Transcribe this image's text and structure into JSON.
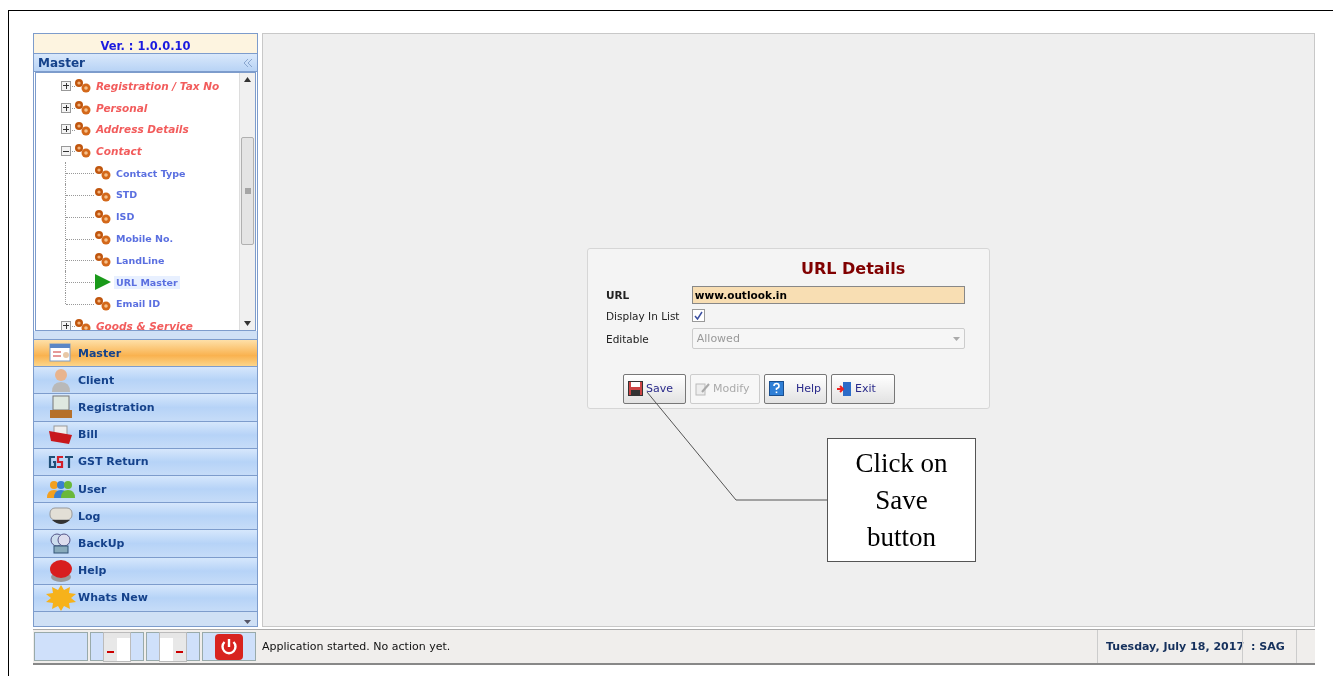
{
  "app": {
    "version": "Ver. : 1.0.0.10"
  },
  "sidebar": {
    "title": "Master",
    "tree": [
      {
        "label": "Registration / Tax No",
        "expanded": false
      },
      {
        "label": "Personal",
        "expanded": false
      },
      {
        "label": "Address Details",
        "expanded": false
      },
      {
        "label": "Contact",
        "expanded": true,
        "children": [
          {
            "label": "Contact Type",
            "selected": false
          },
          {
            "label": "STD",
            "selected": false
          },
          {
            "label": "ISD",
            "selected": false
          },
          {
            "label": "Mobile No.",
            "selected": false
          },
          {
            "label": "LandLine",
            "selected": false
          },
          {
            "label": "URL Master",
            "selected": true
          },
          {
            "label": "Email ID",
            "selected": false
          }
        ]
      },
      {
        "label": "Goods & Service",
        "expanded": false
      }
    ],
    "nav": [
      {
        "label": "Master",
        "selected": true
      },
      {
        "label": "Client",
        "selected": false
      },
      {
        "label": "Registration",
        "selected": false
      },
      {
        "label": "Bill",
        "selected": false
      },
      {
        "label": "GST Return",
        "selected": false
      },
      {
        "label": "User",
        "selected": false
      },
      {
        "label": "Log",
        "selected": false
      },
      {
        "label": "BackUp",
        "selected": false
      },
      {
        "label": "Help",
        "selected": false
      },
      {
        "label": "Whats New",
        "selected": false
      }
    ]
  },
  "dialog": {
    "title": "URL Details",
    "fields": [
      {
        "kind": "text",
        "label": "URL",
        "value": "www.outlook.in"
      },
      {
        "kind": "checkbox",
        "label": "Display In List",
        "checked": true
      },
      {
        "kind": "dropdown",
        "label": "Editable",
        "value": "Allowed",
        "disabled": true
      }
    ],
    "buttons": [
      {
        "label": "Save",
        "disabled": false
      },
      {
        "label": "Modify",
        "disabled": true
      },
      {
        "label": "Help",
        "disabled": false
      },
      {
        "label": "Exit",
        "disabled": false
      }
    ]
  },
  "status_bar": {
    "message": "Application started. No action yet.",
    "date": "Tuesday, July 18, 2017",
    "user": ": SAG"
  },
  "callout": {
    "text": "Click on Save button"
  }
}
